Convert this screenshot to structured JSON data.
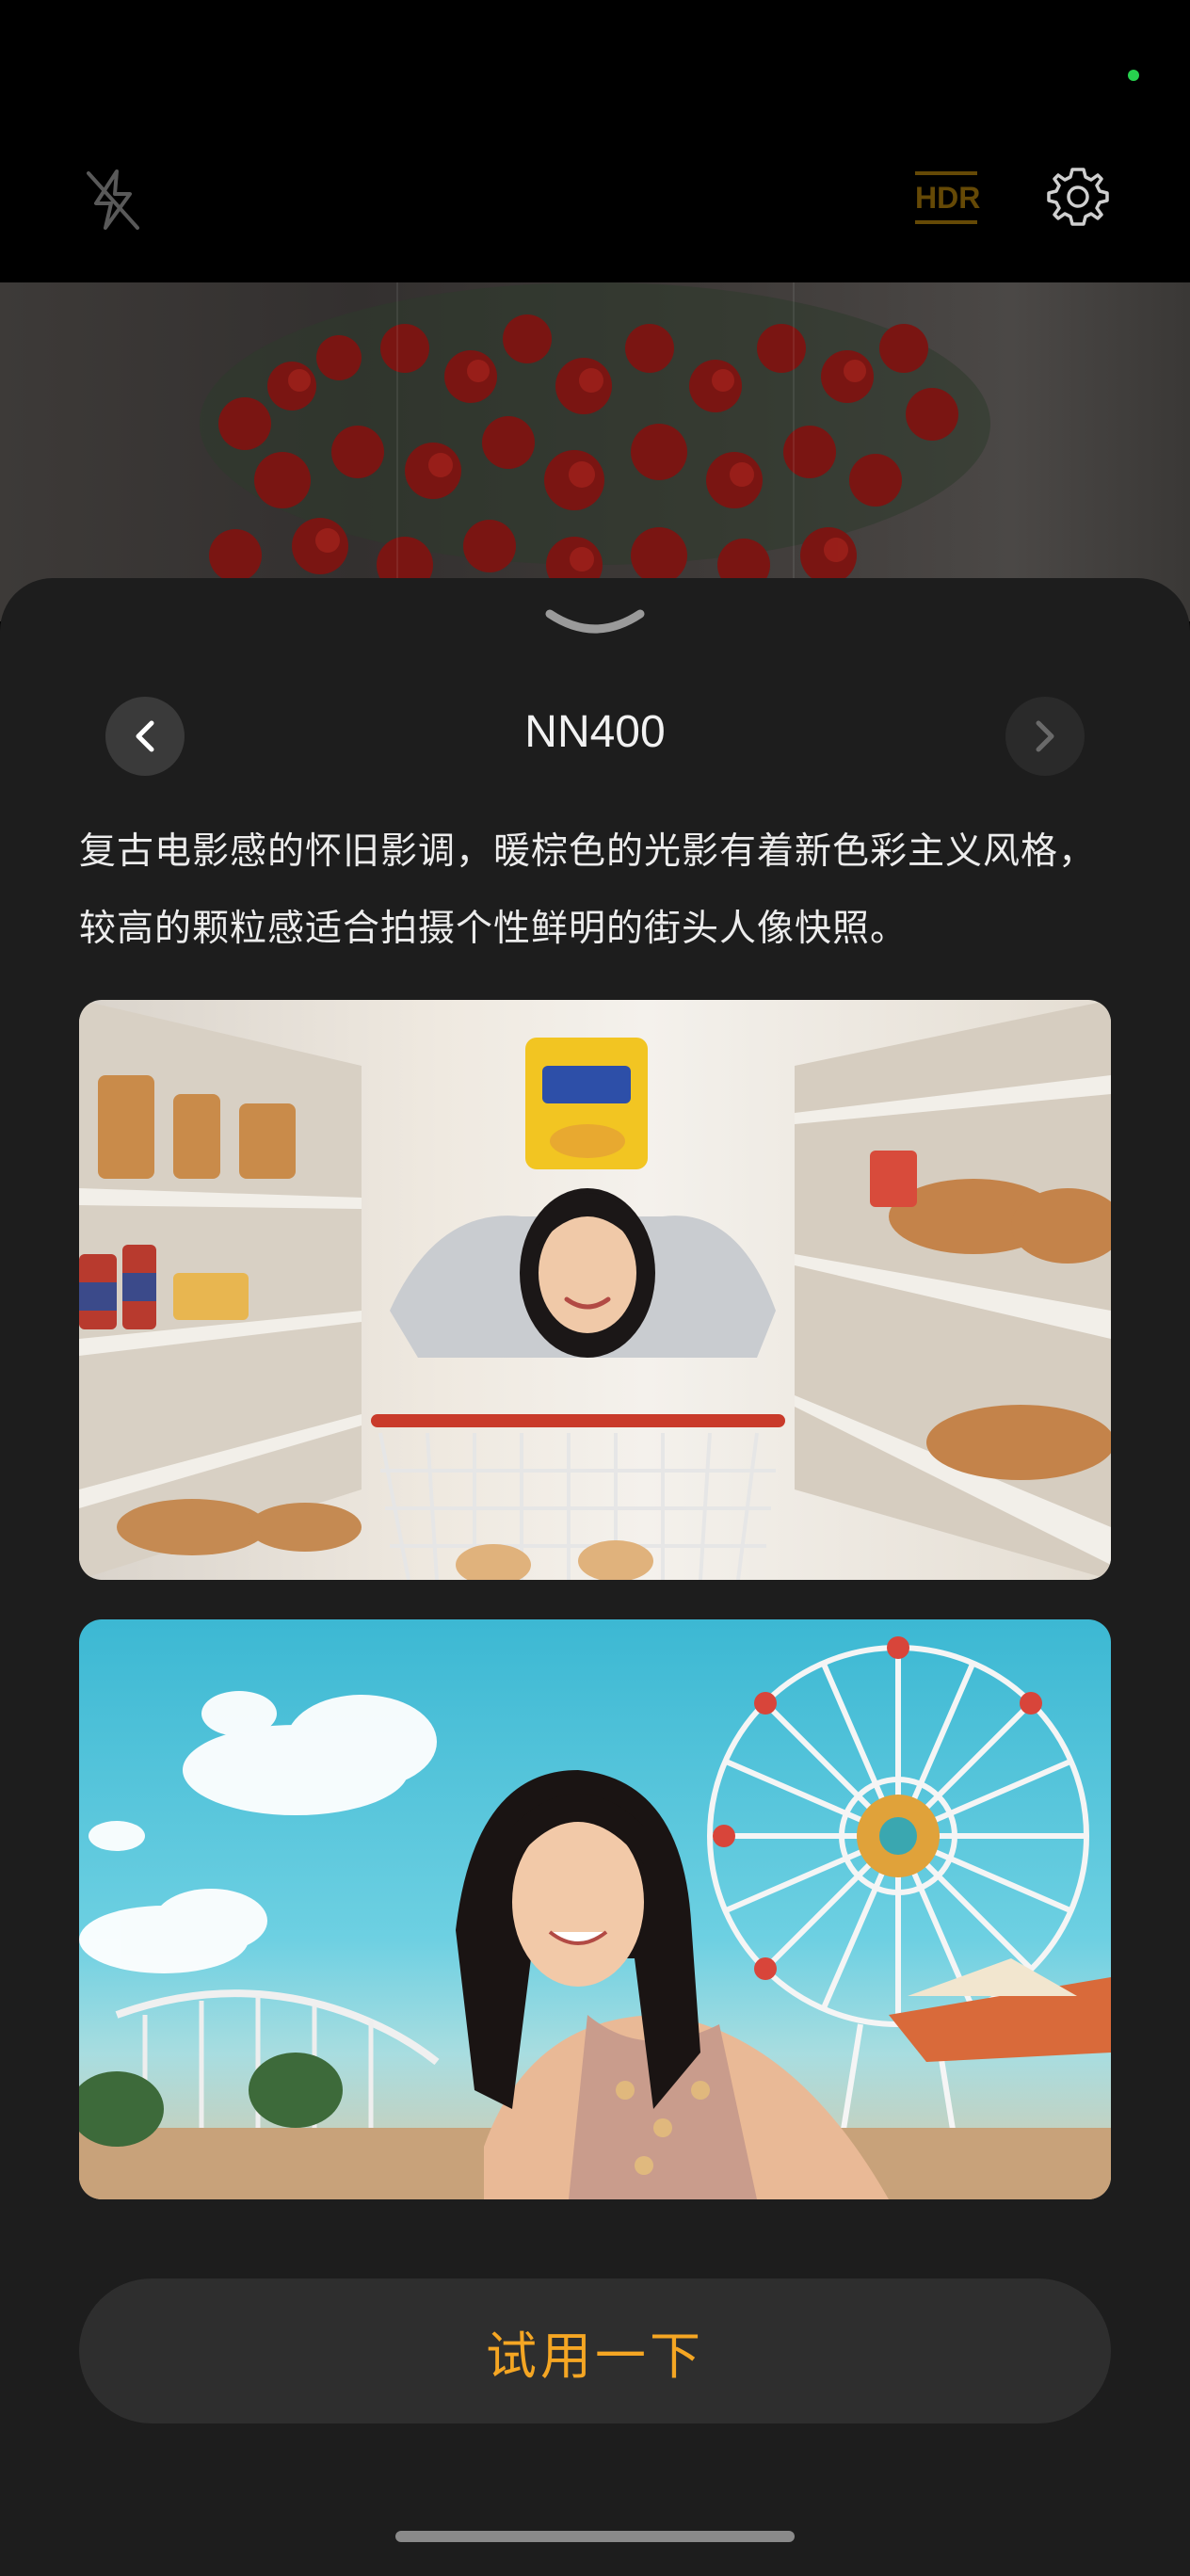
{
  "camera": {
    "hdr_label": "HDR",
    "icons": [
      "flash-off-icon",
      "hdr-icon",
      "settings-gear-icon"
    ]
  },
  "filter_sheet": {
    "title": "NN400",
    "description": "复古电影感的怀旧影调，暖棕色的光影有着新色彩主义风格，较高的颗粒感适合拍摄个性鲜明的街头人像快照。",
    "samples": [
      {
        "subject": "girl-in-supermarket-aisle"
      },
      {
        "subject": "girl-at-amusement-park-ferris-wheel"
      }
    ],
    "try_button_label": "试用一下"
  },
  "colors": {
    "accent": "#f5a623",
    "sheet_background": "#1d1d1d",
    "button_background": "#2e2e2e",
    "status_indicator": "#27d14e"
  }
}
